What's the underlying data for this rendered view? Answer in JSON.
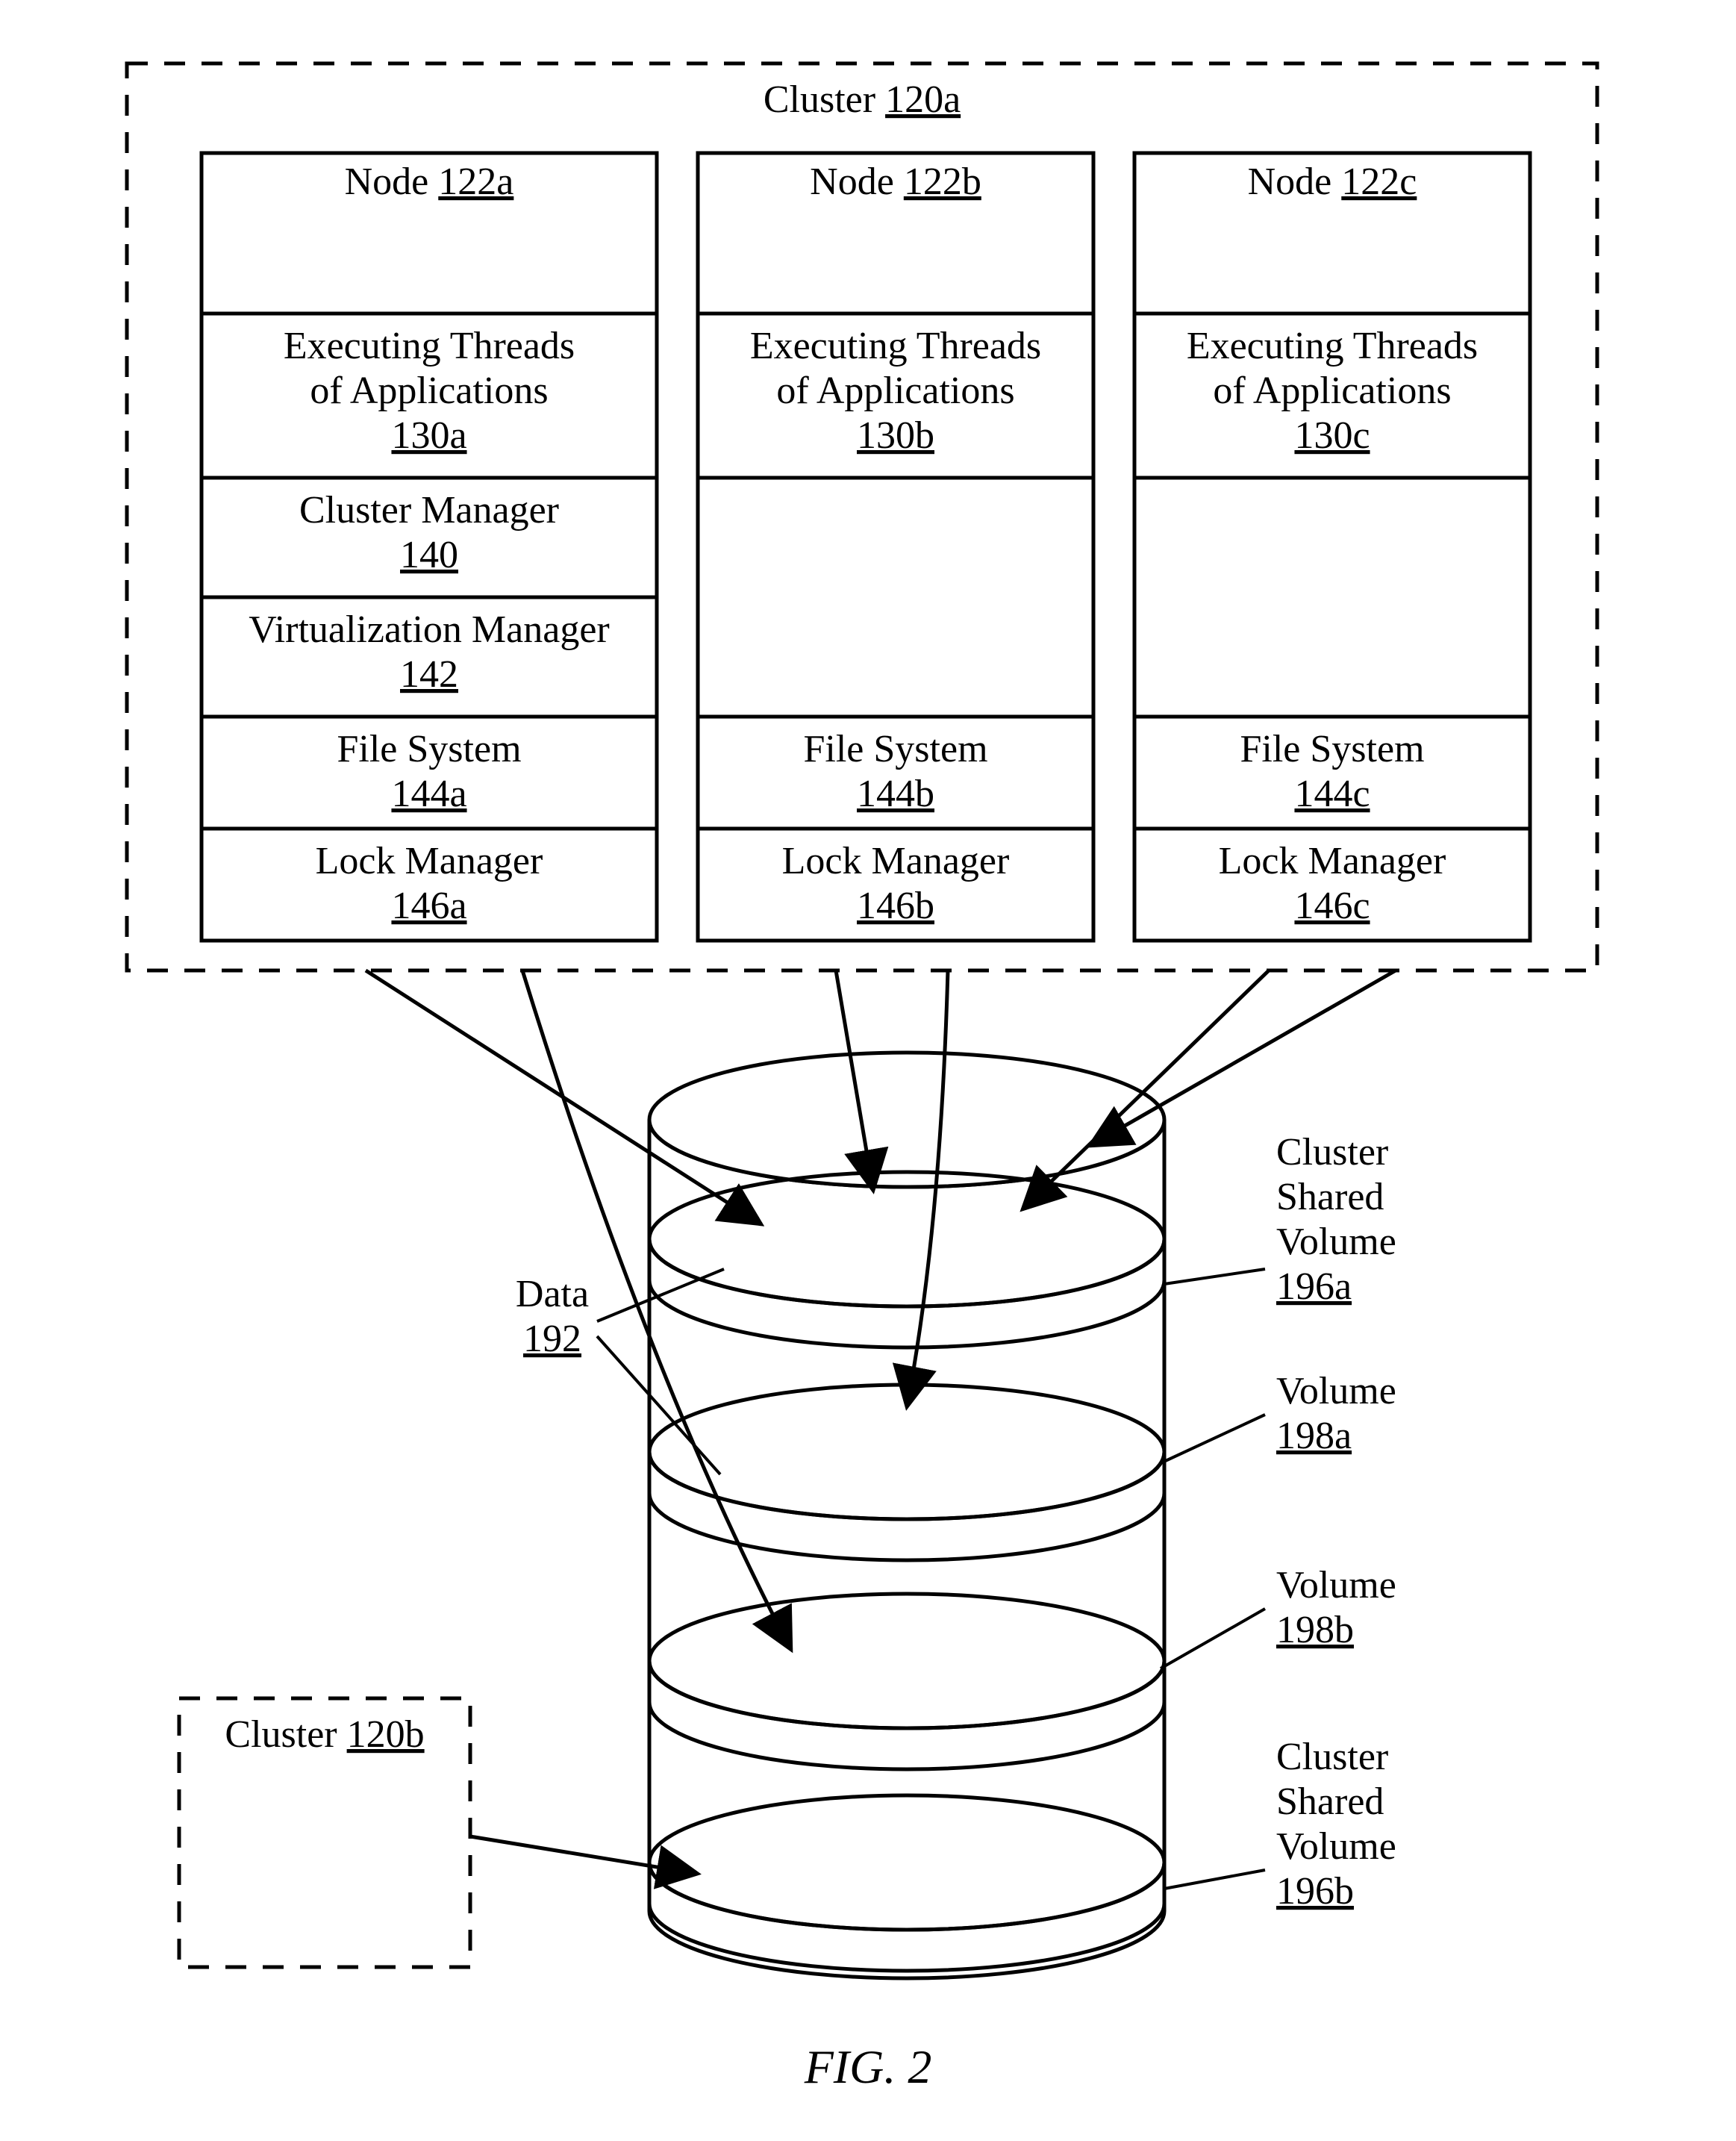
{
  "figure_label": "FIG. 2",
  "cluster_a": {
    "label": "Cluster",
    "ref": "120a"
  },
  "cluster_b": {
    "label": "Cluster",
    "ref": "120b"
  },
  "nodes": {
    "a": {
      "title": "Node",
      "ref": "122a",
      "threads_l1": "Executing Threads",
      "threads_l2": "of Applications",
      "threads_ref": "130a",
      "cm_label": "Cluster Manager",
      "cm_ref": "140",
      "vm_label": "Virtualization Manager",
      "vm_ref": "142",
      "fs_label": "File System",
      "fs_ref": "144a",
      "lm_label": "Lock Manager",
      "lm_ref": "146a"
    },
    "b": {
      "title": "Node",
      "ref": "122b",
      "threads_l1": "Executing Threads",
      "threads_l2": "of Applications",
      "threads_ref": "130b",
      "fs_label": "File System",
      "fs_ref": "144b",
      "lm_label": "Lock Manager",
      "lm_ref": "146b"
    },
    "c": {
      "title": "Node",
      "ref": "122c",
      "threads_l1": "Executing Threads",
      "threads_l2": "of Applications",
      "threads_ref": "130c",
      "fs_label": "File System",
      "fs_ref": "144c",
      "lm_label": "Lock Manager",
      "lm_ref": "146c"
    }
  },
  "data": {
    "label": "Data",
    "ref": "192"
  },
  "csv_a": {
    "l1": "Cluster",
    "l2": "Shared",
    "l3": "Volume",
    "ref": "196a"
  },
  "csv_b": {
    "l1": "Cluster",
    "l2": "Shared",
    "l3": "Volume",
    "ref": "196b"
  },
  "vol_a": {
    "label": "Volume",
    "ref": "198a"
  },
  "vol_b": {
    "label": "Volume",
    "ref": "198b"
  }
}
